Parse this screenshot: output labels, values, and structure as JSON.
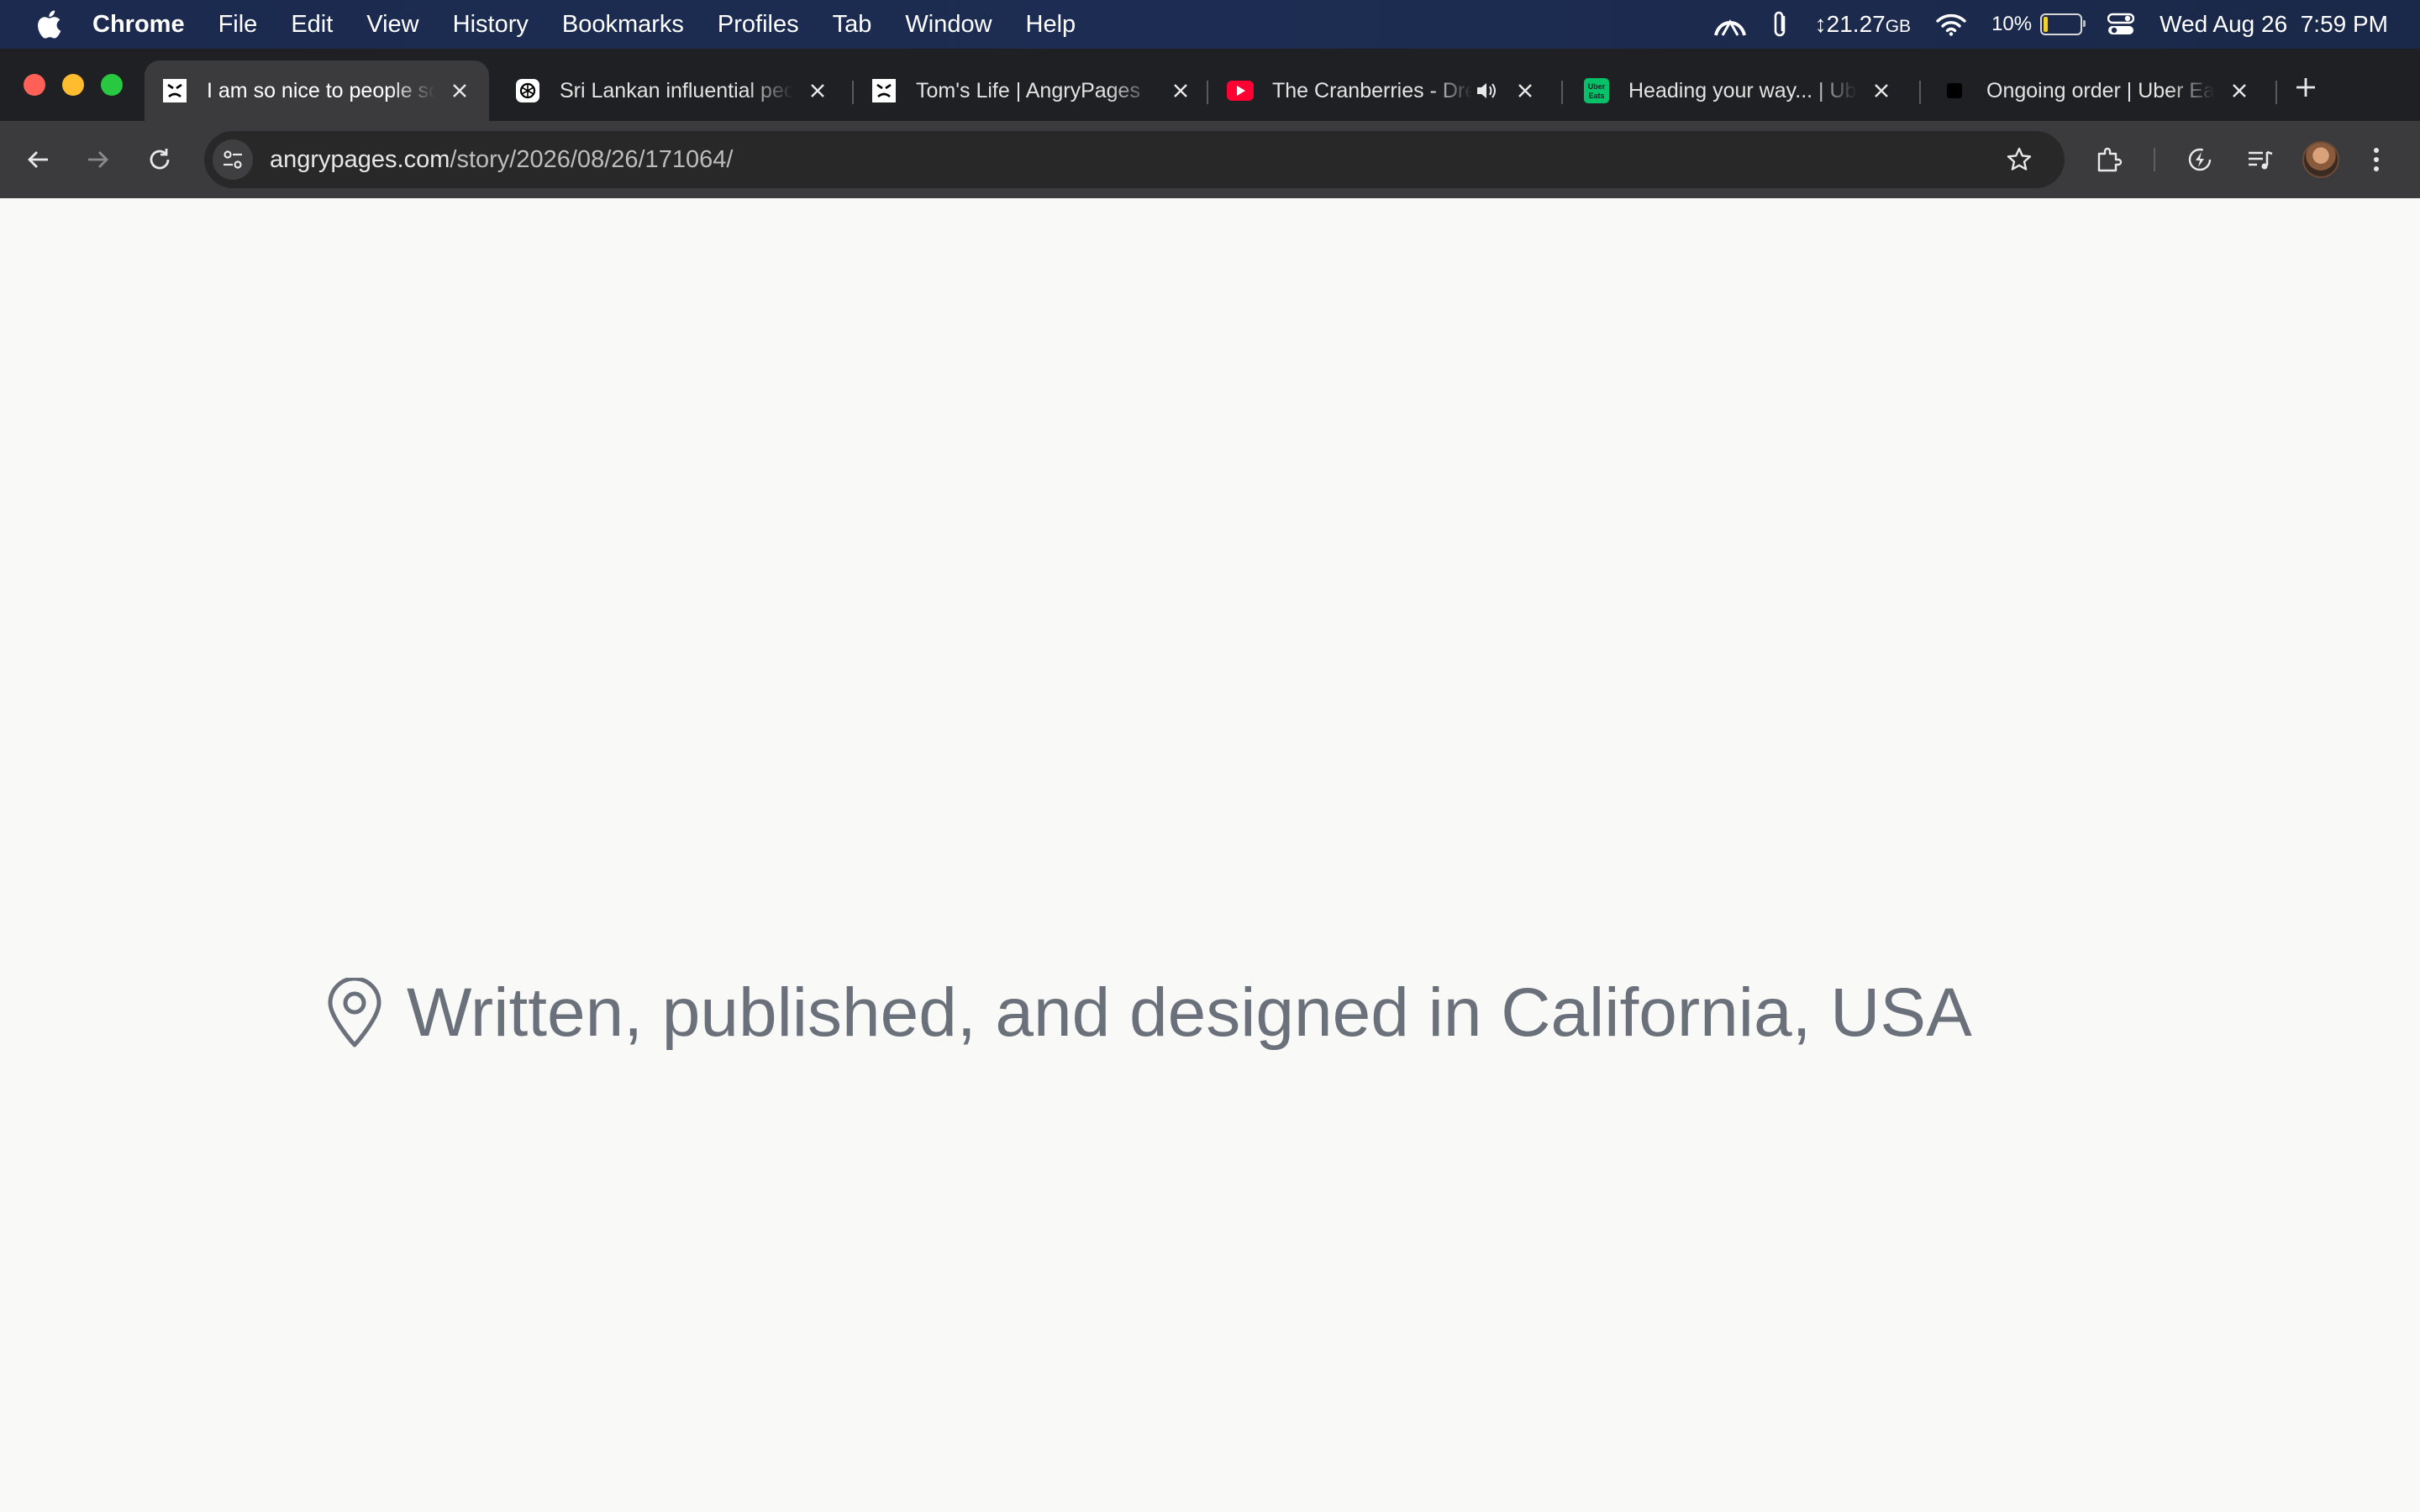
{
  "menubar": {
    "app_name": "Chrome",
    "menus": [
      "File",
      "Edit",
      "View",
      "History",
      "Bookmarks",
      "Profiles",
      "Tab",
      "Window",
      "Help"
    ],
    "storage_value": "21.27",
    "storage_unit": "GB",
    "battery_percent_label": "10%",
    "battery_level": 0.1,
    "datetime": "Wed Aug 26  7:59 PM"
  },
  "tabs": [
    {
      "title": "I am so nice to people so",
      "favicon": "angrypages-icon",
      "active": true
    },
    {
      "title": "Sri Lankan influential peo",
      "favicon": "openai-icon",
      "active": false
    },
    {
      "title": "Tom's Life | AngryPages",
      "favicon": "angrypages-icon",
      "active": false
    },
    {
      "title": "The Cranberries - Dre",
      "favicon": "youtube-icon",
      "active": false,
      "audio": true
    },
    {
      "title": "Heading your way... | Ube",
      "favicon": "ubereats-icon",
      "active": false
    },
    {
      "title": "Ongoing order | Uber Eat",
      "favicon": "uber-icon",
      "active": false
    }
  ],
  "omnibox": {
    "url_host": "angrypages.com",
    "url_path": "/story/2026/08/26/171064/"
  },
  "page": {
    "location_text": "Written, published, and designed in California, USA"
  },
  "colors": {
    "menubar_bg": "#1b2a4e",
    "tabstrip_bg": "#1f2023",
    "toolbar_bg": "#3b3b3d",
    "page_bg": "#f9f9f8",
    "location_text": "#6b717a"
  }
}
